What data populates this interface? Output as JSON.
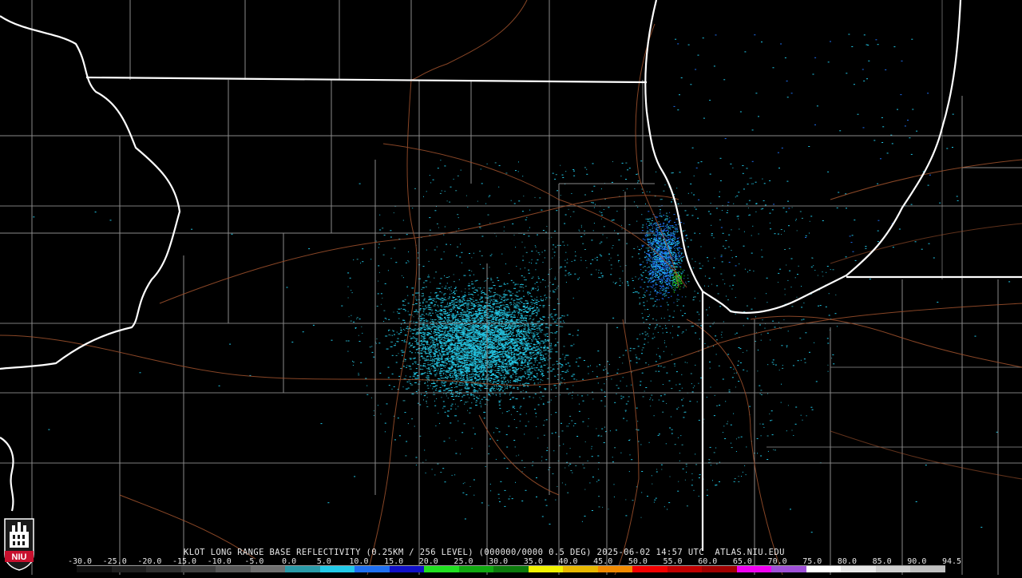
{
  "radar": {
    "title": "KLOT LONG RANGE BASE REFLECTIVITY (0.25KM / 256 LEVEL) (000000/0000 0.5 DEG) 2025-06-02 14:57 UTC  ATLAS.NIU.EDU",
    "product": "Base Reflectivity",
    "station": "KLOT",
    "timestamp": "2025-06-02 14:57 UTC"
  },
  "legend": {
    "labels": [
      "-30.0",
      "-25.0",
      "-20.0",
      "-15.0",
      "-10.0",
      "-5.0",
      "0.0",
      "5.0",
      "10.0",
      "15.0",
      "20.0",
      "25.0",
      "30.0",
      "35.0",
      "40.0",
      "45.0",
      "50.0",
      "55.0",
      "60.0",
      "65.0",
      "70.0",
      "75.0",
      "80.0",
      "85.0",
      "90.0",
      "94.5"
    ],
    "colors": [
      "#101010",
      "#202020",
      "#303030",
      "#404040",
      "#585858",
      "#707070",
      "#2a9aa8",
      "#22c9e8",
      "#1e6ff2",
      "#1010c8",
      "#20e020",
      "#10a810",
      "#0c7a0c",
      "#f2f200",
      "#e8b800",
      "#f28a00",
      "#f20000",
      "#c00000",
      "#a00000",
      "#f000f0",
      "#a050d8",
      "#ffffff",
      "#e8e8e8",
      "#d0d0d0",
      "#c0c0c0"
    ]
  },
  "logo": {
    "text": "NIU",
    "color": "#c8102e"
  }
}
